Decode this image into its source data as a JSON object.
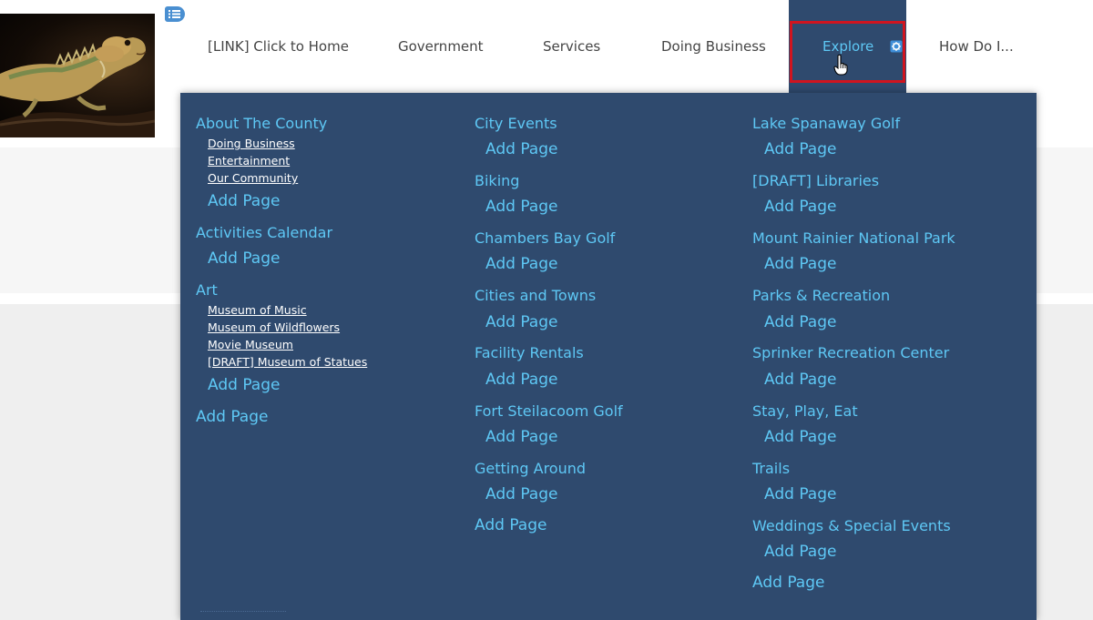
{
  "nav": {
    "home": "[LINK] Click to Home",
    "government": "Government",
    "services": "Services",
    "doing_business": "Doing Business",
    "explore": "Explore",
    "how_do_i": "How Do I..."
  },
  "colors": {
    "nav_active_bg": "#2f4a6e",
    "link_accent": "#5ec8f5",
    "focus_outline": "#d0141f"
  },
  "icons": {
    "edit_badge": "list-icon",
    "settings": "gear-icon",
    "cursor": "hand-pointer-icon"
  },
  "menu": {
    "col1": {
      "about": "About The County",
      "about_sub": [
        "Doing Business",
        "Entertainment",
        "Our Community"
      ],
      "about_add": "Add Page",
      "activities": "Activities Calendar",
      "activities_add": "Add Page",
      "art": "Art",
      "art_sub": [
        "Museum of Music",
        "Museum of Wildflowers",
        "Movie Museum",
        "[DRAFT] Museum of Statues"
      ],
      "art_add": "Add Page",
      "col_add": "Add Page"
    },
    "col2": {
      "items": [
        {
          "label": "City Events",
          "add": "Add Page"
        },
        {
          "label": "Biking",
          "add": "Add Page"
        },
        {
          "label": "Chambers Bay Golf",
          "add": "Add Page"
        },
        {
          "label": "Cities and Towns",
          "add": "Add Page"
        },
        {
          "label": "Facility Rentals",
          "add": "Add Page"
        },
        {
          "label": "Fort Steilacoom Golf",
          "add": "Add Page"
        },
        {
          "label": "Getting Around",
          "add": "Add Page"
        }
      ],
      "col_add": "Add Page"
    },
    "col3": {
      "items": [
        {
          "label": "Lake Spanaway Golf",
          "add": "Add Page"
        },
        {
          "label": "[DRAFT] Libraries",
          "add": "Add Page"
        },
        {
          "label": "Mount Rainier National Park",
          "add": "Add Page"
        },
        {
          "label": "Parks & Recreation",
          "add": "Add Page"
        },
        {
          "label": "Sprinker Recreation Center",
          "add": "Add Page"
        },
        {
          "label": "Stay, Play, Eat",
          "add": "Add Page"
        },
        {
          "label": "Trails",
          "add": "Add Page"
        },
        {
          "label": "Weddings & Special Events",
          "add": "Add Page"
        }
      ],
      "col_add": "Add Page"
    }
  }
}
